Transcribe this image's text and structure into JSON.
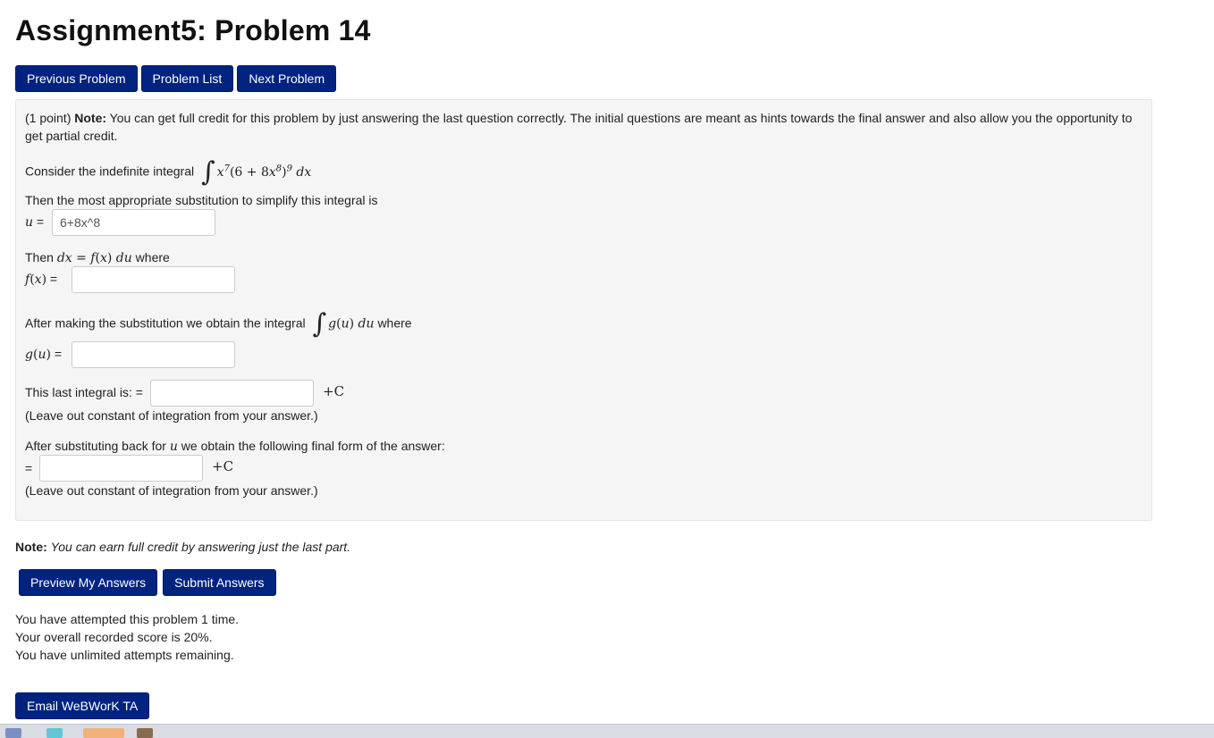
{
  "page": {
    "title": "Assignment5: Problem 14"
  },
  "nav": {
    "previous": "Previous Problem",
    "list": "Problem List",
    "next": "Next Problem"
  },
  "problem": {
    "points": "(1 point)",
    "note_label": "Note:",
    "note_text": "You can get full credit for this problem by just answering the last question correctly. The initial questions are meant as hints towards the final answer and also allow you the opportunity to",
    "note_text2": "get partial credit.",
    "consider_text": "Consider the indefinite integral",
    "substitution_text": "Then the most appropriate substitution to simplify this integral is",
    "u_label_suffix": "=",
    "u_value": "6+8x^8",
    "then_text": "Then",
    "where_text": "where",
    "fx_label_suffix": "=",
    "fx_value": "",
    "after_sub_text": "After making the substitution we obtain the integral",
    "gu_label_suffix": "=",
    "gu_value": "",
    "last_integral_text": "This last integral is: =",
    "last_integral_value": "",
    "leave_out_1": "(Leave out constant of integration from your answer.)",
    "after_back_text_1": "After substituting back for",
    "after_back_text_2": "we obtain the following final form of the answer:",
    "final_eq": "=",
    "final_value": "",
    "leave_out_2": "(Leave out constant of integration from your answer.)",
    "plus_c": "+C"
  },
  "footer_note": {
    "label": "Note:",
    "text": "You can earn full credit by answering just the last part."
  },
  "actions": {
    "preview": "Preview My Answers",
    "submit": "Submit Answers"
  },
  "status": {
    "attempts": "You have attempted this problem 1 time.",
    "score": "Your overall recorded score is 20%.",
    "remaining": "You have unlimited attempts remaining."
  },
  "email": {
    "label": "Email WeBWorK TA"
  },
  "colors": {
    "button_bg": "#00237f",
    "panel_bg": "#f5f5f5"
  }
}
